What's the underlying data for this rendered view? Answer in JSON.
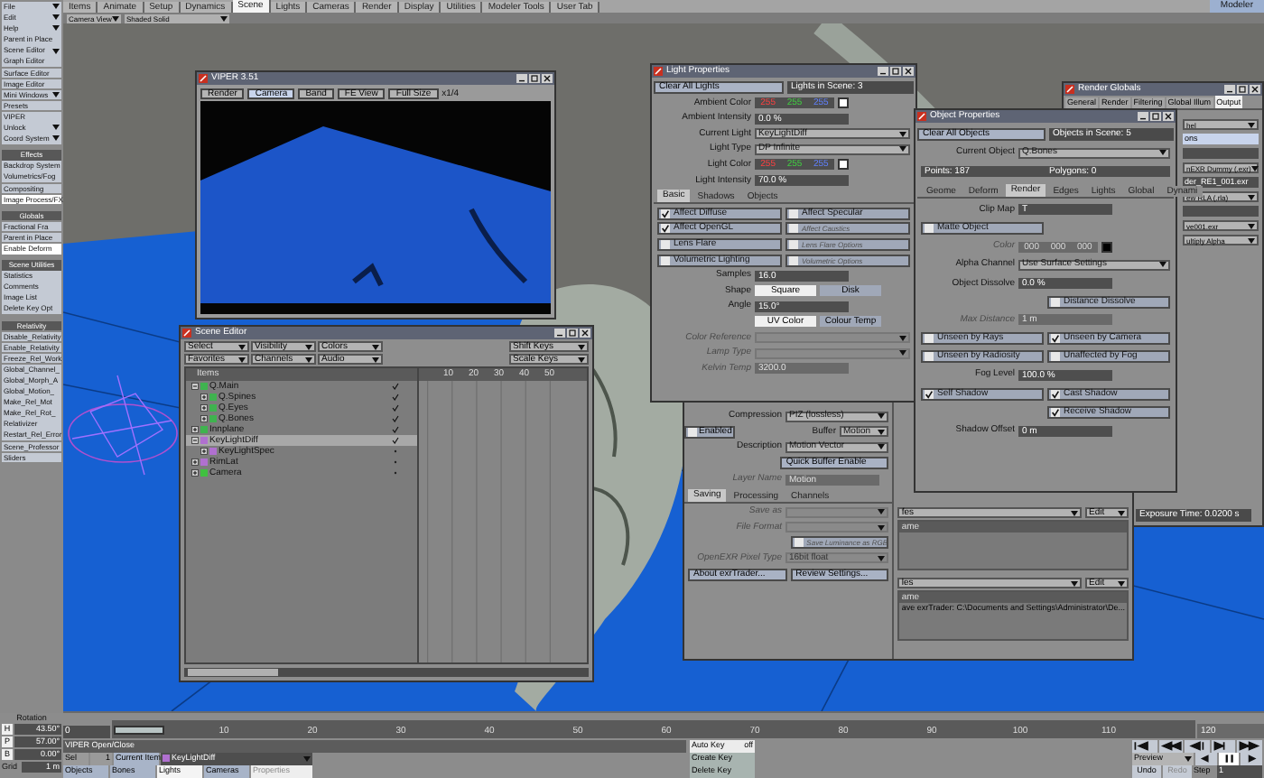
{
  "menu_tabs": [
    {
      "label": "Items",
      "selected": false
    },
    {
      "label": "Animate",
      "selected": false
    },
    {
      "label": "Setup",
      "selected": false
    },
    {
      "label": "Dynamics",
      "selected": false
    },
    {
      "label": "Scene",
      "selected": true
    },
    {
      "label": "Lights",
      "selected": false
    },
    {
      "label": "Cameras",
      "selected": false
    },
    {
      "label": "Render",
      "selected": false
    },
    {
      "label": "Display",
      "selected": false
    },
    {
      "label": "Utilities",
      "selected": false
    },
    {
      "label": "Modeler Tools",
      "selected": false
    },
    {
      "label": "User Tab",
      "selected": false
    }
  ],
  "modeler_button": "Modeler",
  "toolbar": {
    "view": "Camera View",
    "shading": "Shaded Solid"
  },
  "sidebar": [
    {
      "kind": "menu",
      "label": "File"
    },
    {
      "kind": "menu",
      "label": "Edit"
    },
    {
      "kind": "menu",
      "label": "Help"
    },
    {
      "kind": "button",
      "label": "Parent in Place"
    },
    {
      "kind": "menu",
      "label": "Scene Editor"
    },
    {
      "kind": "button",
      "label": "Graph Editor"
    },
    {
      "kind": "button",
      "label": "Surface Editor"
    },
    {
      "kind": "button",
      "label": "Image Editor"
    },
    {
      "kind": "menu",
      "label": "Mini Windows"
    },
    {
      "kind": "button",
      "label": "Presets"
    },
    {
      "kind": "button",
      "label": "VIPER"
    },
    {
      "kind": "menu",
      "label": "Unlock"
    },
    {
      "kind": "menu",
      "label": "Coord System"
    },
    {
      "kind": "header",
      "label": "Effects"
    },
    {
      "kind": "button",
      "label": "Backdrop System"
    },
    {
      "kind": "button",
      "label": "Volumetrics/Fog"
    },
    {
      "kind": "button",
      "label": "Compositing"
    },
    {
      "kind": "active",
      "label": "Image Process/FX"
    },
    {
      "kind": "header",
      "label": "Globals"
    },
    {
      "kind": "button",
      "label": "Fractional Fra"
    },
    {
      "kind": "button",
      "label": "Parent in Place"
    },
    {
      "kind": "active",
      "label": "Enable Deform"
    },
    {
      "kind": "header",
      "label": "Scene Utilities"
    },
    {
      "kind": "button",
      "label": "Statistics"
    },
    {
      "kind": "button",
      "label": "Comments"
    },
    {
      "kind": "button",
      "label": "Image List"
    },
    {
      "kind": "button",
      "label": "Delete Key Opt"
    },
    {
      "kind": "header",
      "label": "Relativity"
    },
    {
      "kind": "button",
      "label": "Disable_Relativity"
    },
    {
      "kind": "button",
      "label": "Enable_Relativity"
    },
    {
      "kind": "button",
      "label": "Freeze_Rel_Work"
    },
    {
      "kind": "button",
      "label": "Global_Channel_"
    },
    {
      "kind": "button",
      "label": "Global_Morph_A"
    },
    {
      "kind": "button",
      "label": "Global_Motion_"
    },
    {
      "kind": "button",
      "label": "Make_Rel_Mot"
    },
    {
      "kind": "button",
      "label": "Make_Rel_Rot_"
    },
    {
      "kind": "button",
      "label": "Relativizer"
    },
    {
      "kind": "button",
      "label": "Restart_Rel_Error"
    },
    {
      "kind": "button",
      "label": "Scene_Professor"
    },
    {
      "kind": "button",
      "label": "Sliders"
    }
  ],
  "viper": {
    "title": "VIPER 3.51",
    "buttons": [
      {
        "label": "Render",
        "selected": false
      },
      {
        "label": "Camera",
        "selected": true
      },
      {
        "label": "Band",
        "selected": false
      },
      {
        "label": "FE View",
        "selected": false
      },
      {
        "label": "Full Size",
        "selected": false
      }
    ],
    "scale": "x1/4"
  },
  "scene_editor": {
    "title": "Scene Editor",
    "dropdowns": [
      "Select",
      "Visibility",
      "Colors",
      "Favorites",
      "Channels",
      "Audio"
    ],
    "key_buttons": [
      "Shift Keys",
      "Scale Keys"
    ],
    "column_header": "Items",
    "ticks": [
      "10",
      "20",
      "30",
      "40",
      "50"
    ],
    "items": [
      {
        "label": "Q.Main",
        "kind": "object",
        "expanded": true,
        "selected": false,
        "visible": true,
        "children": [
          {
            "label": "Q.Spines",
            "kind": "object",
            "expanded": false,
            "selected": false,
            "visible": true
          },
          {
            "label": "Q.Eyes",
            "kind": "object",
            "expanded": false,
            "selected": false,
            "visible": true
          },
          {
            "label": "Q.Bones",
            "kind": "object",
            "expanded": false,
            "selected": false,
            "visible": true
          }
        ]
      },
      {
        "label": "Innplane",
        "kind": "object",
        "expanded": false,
        "selected": false,
        "visible": true
      },
      {
        "label": "KeyLightDiff",
        "kind": "light",
        "expanded": true,
        "selected": true,
        "visible": true,
        "children": [
          {
            "label": "KeyLightSpec",
            "kind": "light",
            "expanded": false,
            "selected": false,
            "visible": false
          }
        ]
      },
      {
        "label": "RimLat",
        "kind": "light",
        "expanded": false,
        "selected": false,
        "visible": false
      },
      {
        "label": "Camera",
        "kind": "camera",
        "expanded": false,
        "selected": false,
        "visible": false
      }
    ]
  },
  "light_properties": {
    "title": "Light Properties",
    "rows": [
      {
        "kind": "top",
        "button": "Clear All Lights",
        "info": "Lights in Scene: 3"
      },
      {
        "kind": "color",
        "label": "Ambient Color",
        "values": [
          "255",
          "255",
          "255"
        ]
      },
      {
        "kind": "value",
        "label": "Ambient Intensity",
        "value": "0.0 %"
      },
      {
        "kind": "dropdown",
        "label": "Current Light",
        "value": "KeyLightDiff"
      },
      {
        "kind": "dropdown",
        "label": "Light Type",
        "value": "DP Infinite"
      },
      {
        "kind": "color",
        "label": "Light Color",
        "values": [
          "255",
          "255",
          "255"
        ]
      },
      {
        "kind": "value",
        "label": "Light Intensity",
        "value": "70.0 %"
      },
      {
        "kind": "tabs",
        "items": [
          {
            "label": "Basic",
            "selected": true
          },
          {
            "label": "Shadows",
            "selected": false
          },
          {
            "label": "Objects",
            "selected": false
          }
        ]
      },
      {
        "kind": "toggles",
        "items": [
          {
            "label": "Affect Diffuse",
            "checked": true,
            "disabled": false
          },
          {
            "label": "Affect Specular",
            "checked": false,
            "disabled": false
          }
        ]
      },
      {
        "kind": "toggles",
        "items": [
          {
            "label": "Affect OpenGL",
            "checked": true,
            "disabled": false
          },
          {
            "label": "Affect Caustics",
            "checked": false,
            "disabled": true
          }
        ]
      },
      {
        "kind": "toggles",
        "items": [
          {
            "label": "Lens Flare",
            "checked": false,
            "disabled": false
          },
          {
            "label": "Lens Flare Options",
            "checked": false,
            "disabled": true
          }
        ]
      },
      {
        "kind": "toggles",
        "items": [
          {
            "label": "Volumetric Lighting",
            "checked": false,
            "disabled": false
          },
          {
            "label": "Volumetric Options",
            "checked": false,
            "disabled": true
          }
        ]
      },
      {
        "kind": "value",
        "label": "Samples",
        "value": "16.0"
      },
      {
        "kind": "choice",
        "label": "Shape",
        "items": [
          {
            "label": "Square",
            "selected": true
          },
          {
            "label": "Disk",
            "selected": false
          }
        ]
      },
      {
        "kind": "value",
        "label": "Angle",
        "value": "15.0°"
      },
      {
        "kind": "choice",
        "items": [
          {
            "label": "UV Color",
            "selected": true
          },
          {
            "label": "Colour Temp",
            "selected": false
          }
        ]
      },
      {
        "kind": "dropdown",
        "label": "Color Reference",
        "disabled": true
      },
      {
        "kind": "dropdown",
        "label": "Lamp Type",
        "disabled": true
      },
      {
        "kind": "value",
        "label": "Kelvin Temp",
        "value": "3200.0",
        "disabled": true
      }
    ]
  },
  "exr_panel": {
    "rows": [
      {
        "kind": "dropdown",
        "label": "Compression",
        "value": "PIZ (lossless)"
      },
      {
        "kind": "dropdown",
        "label": "Buffer",
        "value": "Motion",
        "toggle": {
          "label": "Enabled",
          "checked": false
        }
      },
      {
        "kind": "dropdown",
        "label": "Description",
        "value": "Motion Vector"
      },
      {
        "kind": "buttons",
        "items": [
          {
            "label": "Quick Buffer Enable"
          }
        ]
      },
      {
        "kind": "value",
        "label": "Layer Name",
        "value": "Motion",
        "disabled": true
      },
      {
        "kind": "tabs",
        "items": [
          {
            "label": "Saving",
            "selected": true
          },
          {
            "label": "Processing",
            "selected": false
          },
          {
            "label": "Channels",
            "selected": false
          }
        ]
      },
      {
        "kind": "dropdown",
        "label": "Save as",
        "disabled": true
      },
      {
        "kind": "dropdown",
        "label": "File Format",
        "disabled": true
      },
      {
        "kind": "toggles_right",
        "items": [
          {
            "label": "Save Luminance as RGB",
            "checked": false,
            "disabled": true
          }
        ]
      },
      {
        "kind": "dropdown",
        "label": "OpenEXR Pixel Type",
        "value": "16bit float",
        "disabled": true
      },
      {
        "kind": "buttons",
        "items": [
          {
            "label": "About exrTrader..."
          },
          {
            "label": "Review Settings..."
          }
        ]
      }
    ],
    "lists": [
      {
        "filter": "fes",
        "edit": "Edit",
        "header": "ame"
      },
      {
        "filter": "les",
        "edit": "Edit",
        "header": "ame",
        "entries": [
          "ave exrTrader: C:\\Documents and Settings\\Administrator\\De..."
        ]
      }
    ]
  },
  "object_properties": {
    "title": "Object Properties",
    "rows": [
      {
        "kind": "top",
        "button": "Clear All Objects",
        "info": "Objects in Scene: 5"
      },
      {
        "kind": "dropdown",
        "label": "Current Object",
        "value": "Q.Bones"
      },
      {
        "kind": "pair",
        "items": [
          "Points: 187",
          "Polygons: 0"
        ]
      },
      {
        "kind": "tabs",
        "items": [
          {
            "label": "Geome",
            "selected": false
          },
          {
            "label": "Deform",
            "selected": false
          },
          {
            "label": "Render",
            "selected": true
          },
          {
            "label": "Edges",
            "selected": false
          },
          {
            "label": "Lights",
            "selected": false
          },
          {
            "label": "Global",
            "selected": false
          },
          {
            "label": "Dynami",
            "selected": false
          }
        ]
      },
      {
        "kind": "value",
        "label": "Clip Map",
        "value": "T"
      },
      {
        "kind": "toggles",
        "items": [
          {
            "label": "Matte Object",
            "checked": false,
            "disabled": false
          }
        ]
      },
      {
        "kind": "color",
        "label": "Color",
        "values": [
          "000",
          "000",
          "000"
        ],
        "disabled": true
      },
      {
        "kind": "dropdown",
        "label": "Alpha Channel",
        "value": "Use Surface Settings"
      },
      {
        "kind": "value",
        "label": "Object Dissolve",
        "value": "0.0 %"
      },
      {
        "kind": "toggles_right",
        "items": [
          {
            "label": "Distance Dissolve",
            "checked": false,
            "disabled": false
          }
        ]
      },
      {
        "kind": "value",
        "label": "Max Distance",
        "value": "1 m",
        "disabled": true
      },
      {
        "kind": "toggles",
        "items": [
          {
            "label": "Unseen by Rays",
            "checked": false,
            "disabled": false
          },
          {
            "label": "Unseen by Camera",
            "checked": true,
            "disabled": false
          }
        ]
      },
      {
        "kind": "toggles",
        "items": [
          {
            "label": "Unseen by Radiosity",
            "checked": false,
            "disabled": false
          },
          {
            "label": "Unaffected by Fog",
            "checked": false,
            "disabled": false
          }
        ]
      },
      {
        "kind": "value",
        "label": "Fog Level",
        "value": "100.0 %"
      },
      {
        "kind": "toggles",
        "items": [
          {
            "label": "Self Shadow",
            "checked": true,
            "disabled": false
          },
          {
            "label": "Cast Shadow",
            "checked": true,
            "disabled": false
          }
        ]
      },
      {
        "kind": "toggles_right",
        "items": [
          {
            "label": "Receive Shadow",
            "checked": true,
            "disabled": false
          }
        ]
      },
      {
        "kind": "value",
        "label": "Shadow Offset",
        "value": "0 m"
      }
    ]
  },
  "render_globals": {
    "title": "Render Globals",
    "tabs": [
      {
        "label": "General",
        "selected": false
      },
      {
        "label": "Render",
        "selected": false
      },
      {
        "label": "Filtering",
        "selected": false
      },
      {
        "label": "Global Illum",
        "selected": false
      },
      {
        "label": "Output",
        "selected": true
      }
    ],
    "rows": [
      {
        "kind": "dropdown",
        "value": "hel"
      },
      {
        "kind": "light",
        "value": "ons"
      },
      {
        "kind": "dark"
      },
      {
        "kind": "dropdown",
        "value": "nEXR Dummy (.exr)"
      },
      {
        "kind": "dark",
        "value": "der_RE1_001.exr"
      },
      {
        "kind": "dropdown",
        "value": "ew RLA (.rla)"
      },
      {
        "kind": "dark"
      },
      {
        "kind": "dropdown",
        "value": "ve001.exr"
      },
      {
        "kind": "dropdown",
        "value": "ultiply Alpha"
      }
    ],
    "exposure": "Exposure Time: 0.0200 s"
  },
  "bottom": {
    "rotation_label": "Rotation",
    "rotation": [
      {
        "axis": "H",
        "value": "43.50°"
      },
      {
        "axis": "P",
        "value": "57.00°"
      },
      {
        "axis": "B",
        "value": "0.00°"
      }
    ],
    "grid": {
      "label": "Grid",
      "value": "1 m"
    },
    "current_frame": "0",
    "ticks": [
      "10",
      "20",
      "30",
      "40",
      "50",
      "60",
      "70",
      "80",
      "90",
      "100",
      "110"
    ],
    "end_frame": "120",
    "viper_toggle": "VIPER Open/Close",
    "sel": {
      "label": "Sel",
      "value": "1"
    },
    "current_item": {
      "label": "Current Item",
      "value": "KeyLightDiff"
    },
    "item_types": [
      {
        "label": "Objects",
        "selected": false
      },
      {
        "label": "Bones",
        "selected": false
      },
      {
        "label": "Lights",
        "selected": true
      },
      {
        "label": "Cameras",
        "selected": false
      }
    ],
    "properties": "Properties",
    "keys": [
      {
        "label": "Auto Key",
        "value": "off"
      },
      {
        "label": "Create Key"
      },
      {
        "label": "Delete Key"
      }
    ],
    "preview": "Preview",
    "undo": "Undo",
    "redo": "Redo",
    "step": {
      "label": "Step",
      "value": "1"
    }
  }
}
